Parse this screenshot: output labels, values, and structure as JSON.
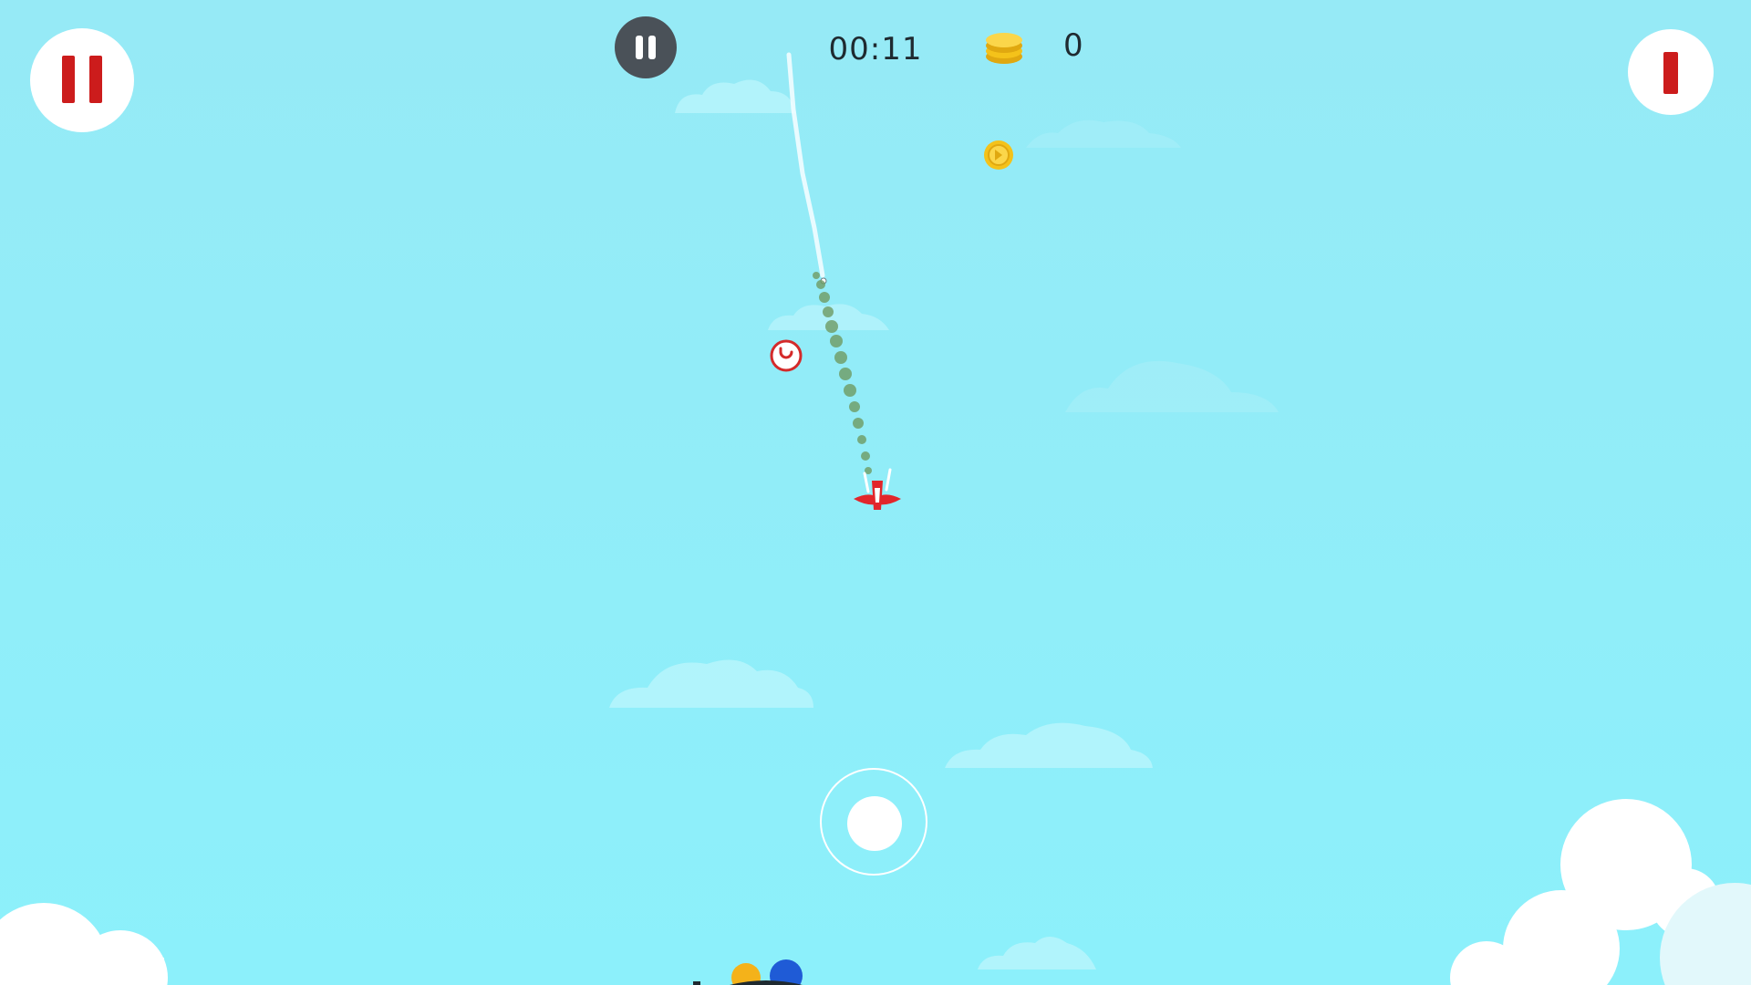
{
  "hud": {
    "timer": "00:11",
    "coins": "0"
  },
  "icons": {
    "pause_left": "pause-icon",
    "pause_center": "pause-icon",
    "alert_right": "exclamation-icon",
    "coin_counter": "coin-stack-icon",
    "coin_pickup": "coin-icon",
    "powerup": "magnet-powerup-icon"
  },
  "colors": {
    "sky": "#8fecf9",
    "accent_red": "#cc1c1c",
    "coin_gold": "#f4c21a",
    "hud_text": "#1f2a30",
    "pause_dark": "#4a5158",
    "smoke_green": "#6f9b63"
  }
}
